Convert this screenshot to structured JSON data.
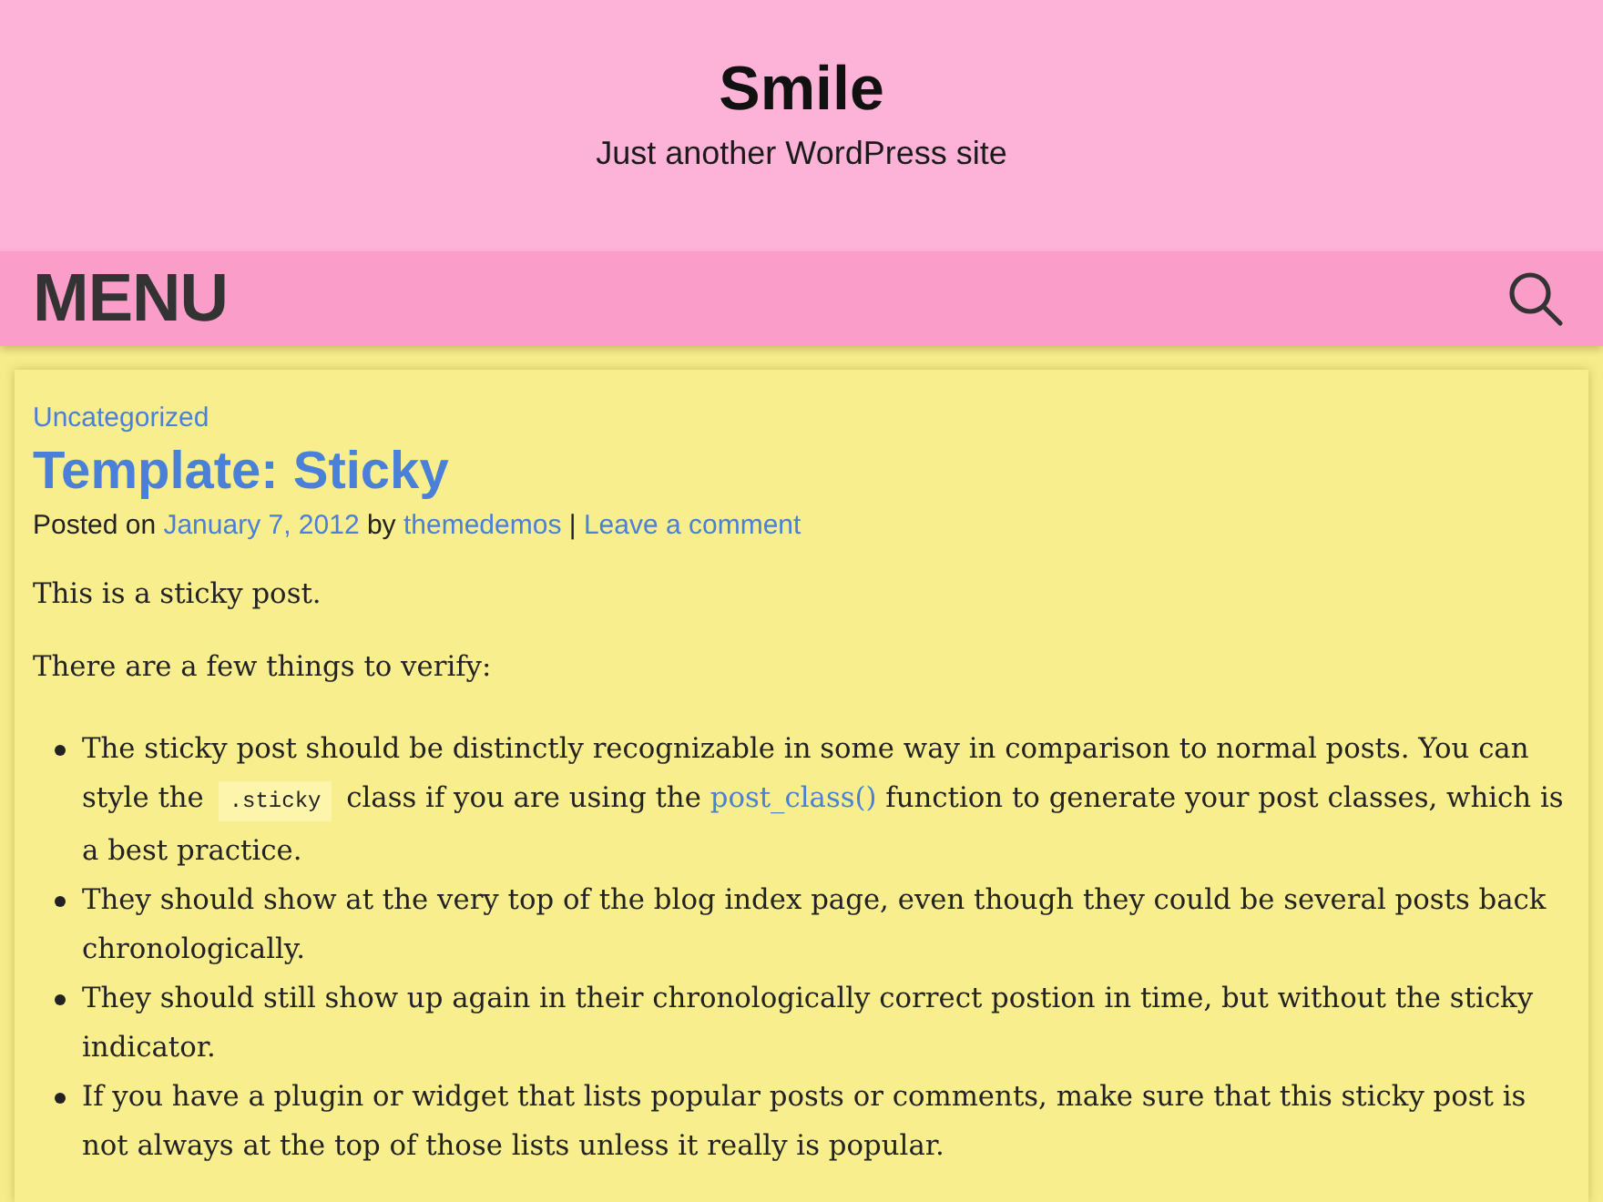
{
  "site_header": {
    "title": "Smile",
    "tagline": "Just another WordPress site"
  },
  "nav": {
    "menu_label": "MENU"
  },
  "post": {
    "category": "Uncategorized",
    "title": "Template: Sticky",
    "meta": [
      {
        "kind": "text",
        "text": "Posted on "
      },
      {
        "kind": "link",
        "text": "January 7, 2012"
      },
      {
        "kind": "text",
        "text": " by "
      },
      {
        "kind": "link",
        "text": "themedemos"
      },
      {
        "kind": "text",
        "text": " | "
      },
      {
        "kind": "link",
        "text": "Leave a comment"
      }
    ],
    "paragraphs": [
      "This is a sticky post.",
      "There are a few things to verify:"
    ],
    "list_items": [
      [
        {
          "kind": "text",
          "text": "The sticky post should be distinctly recognizable in some way in comparison to normal posts. You can style the "
        },
        {
          "kind": "code",
          "text": ".sticky"
        },
        {
          "kind": "text",
          "text": " class if you are using the "
        },
        {
          "kind": "link",
          "text": "post_class()"
        },
        {
          "kind": "text",
          "text": " function to generate your post classes, which is a best practice."
        }
      ],
      [
        {
          "kind": "text",
          "text": "They should show at the very top of the blog index page, even though they could be several posts back chronologically."
        }
      ],
      [
        {
          "kind": "text",
          "text": "They should still show up again in their chronologically correct postion in time, but without the sticky indicator."
        }
      ],
      [
        {
          "kind": "text",
          "text": "If you have a plugin or widget that lists popular posts or comments, make sure that this sticky post is not always at the top of those lists unless it really is popular."
        }
      ]
    ]
  }
}
